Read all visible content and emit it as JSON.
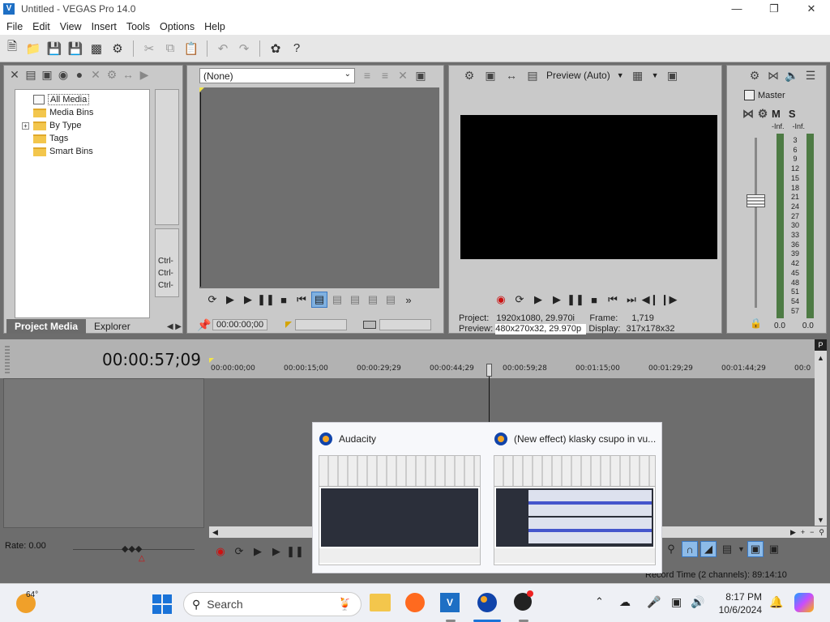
{
  "window": {
    "title": "Untitled - VEGAS Pro 14.0",
    "app_icon": "vegas-icon"
  },
  "menu": [
    "File",
    "Edit",
    "View",
    "Insert",
    "Tools",
    "Options",
    "Help"
  ],
  "project_media": {
    "tree": [
      {
        "label": "All Media",
        "selected": true
      },
      {
        "label": "Media Bins"
      },
      {
        "label": "By Type",
        "expandable": true
      },
      {
        "label": "Tags"
      },
      {
        "label": "Smart Bins"
      }
    ],
    "tabs": [
      "Project Media",
      "Explorer"
    ],
    "shortcut_labels": [
      "Ctrl-",
      "Ctrl-",
      "Ctrl-"
    ]
  },
  "trimmer": {
    "select_value": "(None)",
    "timecode": "00:00:00;00"
  },
  "preview": {
    "mode_label": "Preview (Auto)",
    "info": {
      "project_label": "Project:",
      "project_value": "1920x1080, 29.970i",
      "preview_label": "Preview:",
      "preview_value": "480x270x32, 29.970p",
      "frame_label": "Frame:",
      "frame_value": "1,719",
      "display_label": "Display:",
      "display_value": "317x178x32"
    }
  },
  "mixer": {
    "master_label": "Master",
    "m_label": "M",
    "s_label": "S",
    "peak_left": "-Inf.",
    "peak_right": "-Inf.",
    "scale": [
      "3",
      "6",
      "9",
      "12",
      "15",
      "18",
      "21",
      "24",
      "27",
      "30",
      "33",
      "36",
      "39",
      "42",
      "45",
      "48",
      "51",
      "54",
      "57"
    ],
    "bottom_left": "0.0",
    "bottom_right": "0.0"
  },
  "timeline": {
    "cursor_time": "00:00:57;09",
    "ruler": [
      "00:00:00;00",
      "00:00:15;00",
      "00:00:29;29",
      "00:00:44;29",
      "00:00:59;28",
      "00:01:15;00",
      "00:01:29;29",
      "00:01:44;29",
      "00:0"
    ],
    "rate_label": "Rate: 0.00",
    "record_time": "Record Time (2 channels): 89:14:10"
  },
  "taskbar_popup": {
    "items": [
      {
        "title": "Audacity",
        "icon": "audacity-icon"
      },
      {
        "title": "(New effect) klasky csupo in vu...",
        "icon": "audacity-icon"
      }
    ]
  },
  "taskbar": {
    "weather_temp": "64°",
    "search_placeholder": "Search",
    "time": "8:17 PM",
    "date": "10/6/2024"
  },
  "colors": {
    "accent_blue": "#1e6fc4",
    "panel_dark": "#6f6f6f",
    "panel_light": "#c9c9c9"
  }
}
